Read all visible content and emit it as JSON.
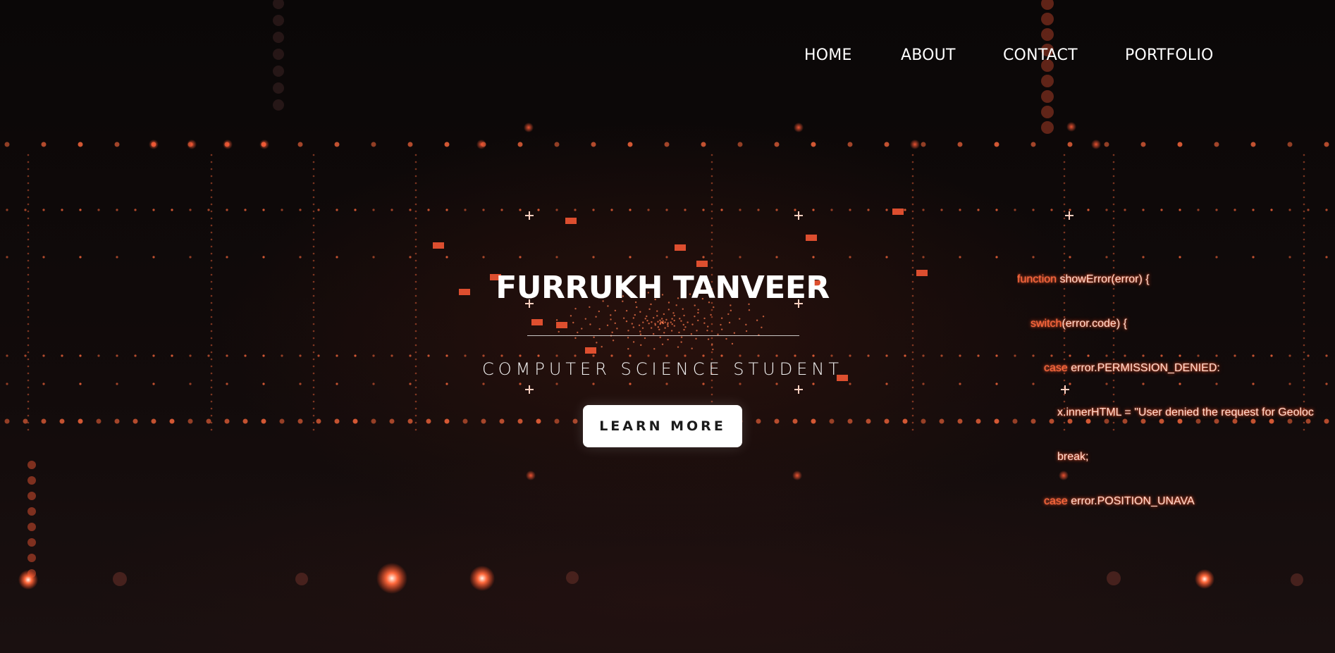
{
  "nav": {
    "items": [
      {
        "label": "HOME"
      },
      {
        "label": "ABOUT"
      },
      {
        "label": "CONTACT"
      },
      {
        "label": "PORTFOLIO"
      }
    ]
  },
  "hero": {
    "title": "FURRUKH TANVEER",
    "subtitle": "COMPUTER SCIENCE STUDENT",
    "cta_label": "LEARN MORE"
  },
  "background_code": {
    "lines": [
      {
        "keyword": "function",
        "text": " showError(error) {"
      },
      {
        "keyword": "switch",
        "text": "(error.code) {"
      },
      {
        "keyword": "case",
        "text": " error.PERMISSION_DENIED:"
      },
      {
        "keyword": "",
        "text": "x.innerHTML = \"User denied the request for Geoloc"
      },
      {
        "keyword": "",
        "text": "break;"
      },
      {
        "keyword": "case",
        "text": " error.POSITION_UNAVA"
      }
    ]
  },
  "colors": {
    "accent": "#ff5a36",
    "background": "#0b0708",
    "text": "#ffffff",
    "button_bg": "#ffffff",
    "button_text": "#1b1b1b"
  }
}
